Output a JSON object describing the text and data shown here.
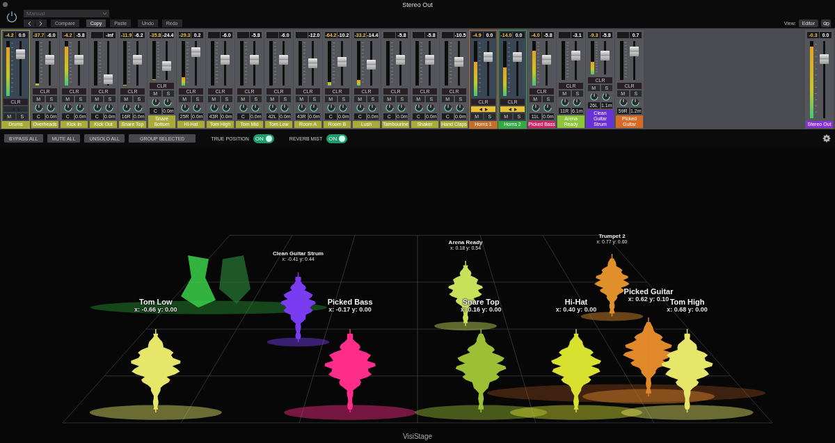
{
  "window": {
    "title": "Stereo Out"
  },
  "toolbar": {
    "preset": "Manual",
    "buttons": [
      {
        "label": "Compare",
        "selected": false
      },
      {
        "label": "Copy",
        "selected": true
      },
      {
        "label": "Paste",
        "selected": false
      },
      {
        "label": "Undo",
        "selected": false
      },
      {
        "label": "Redo",
        "selected": false
      }
    ],
    "view_label": "View:",
    "view_value": "Editor"
  },
  "strips": [
    {
      "kind": "stack",
      "name": "Drums",
      "color": "#a9aa3a",
      "peak": "-4.2",
      "volume": "0.0",
      "clr": "CLR",
      "mute": "M",
      "solo": "S",
      "meter": {
        "level": 0.88
      },
      "fader": {
        "level": 0.82
      }
    },
    {
      "kind": "track",
      "name": "Overheads",
      "color": "#a9aa3a",
      "peak": "-37.7",
      "volume": "-6.0",
      "clr": "CLR",
      "mute": "M",
      "solo": "S",
      "pan": "C",
      "send": "0.0m",
      "meter": {
        "level": 0.04
      },
      "fader": {
        "level": 0.6
      }
    },
    {
      "kind": "track",
      "name": "Kick In",
      "color": "#a9aa3a",
      "peak": "-4.2",
      "volume": "-5.8",
      "clr": "CLR",
      "mute": "M",
      "solo": "S",
      "pan": "C",
      "send": "0.0m",
      "meter": {
        "level": 0.88
      },
      "fader": {
        "level": 0.6
      }
    },
    {
      "kind": "track",
      "name": "Kick Out",
      "color": "#a9aa3a",
      "volume": "-inf",
      "clr": "CLR",
      "mute": "M",
      "solo": "S",
      "pan": "C",
      "send": "0.0m",
      "fader": {
        "level": 0.05
      }
    },
    {
      "kind": "track",
      "name": "Snare Top",
      "color": "#a9aa3a",
      "peak": "-11.9",
      "volume": "-6.2",
      "clr": "CLR",
      "mute": "M",
      "solo": "S",
      "pan": "16R",
      "send": "0.0m",
      "meter": {
        "level": 0.02
      },
      "fader": {
        "level": 0.6
      }
    },
    {
      "kind": "track",
      "name": "Snare Bottom",
      "color": "#a9aa3a",
      "peak": "-35.8",
      "volume": "-24.4",
      "clr": "CLR",
      "mute": "M",
      "solo": "S",
      "pan": "C",
      "send": "0.0m",
      "meter": {
        "level": 0.02
      },
      "fader": {
        "level": 0.3
      }
    },
    {
      "kind": "track",
      "name": "Hi-Hat",
      "color": "#a9aa3a",
      "peak": "-29.3",
      "volume": "0.2",
      "clr": "CLR",
      "mute": "M",
      "solo": "S",
      "pan": "25R",
      "send": "0.0m",
      "meter": {
        "level": 0.18
      },
      "fader": {
        "level": 0.82
      }
    },
    {
      "kind": "track",
      "name": "Tom High",
      "color": "#a9aa3a",
      "volume": "-6.0",
      "clr": "CLR",
      "mute": "M",
      "solo": "S",
      "pan": "43R",
      "send": "0.0m",
      "fader": {
        "level": 0.6
      }
    },
    {
      "kind": "track",
      "name": "Tom Mid",
      "color": "#a9aa3a",
      "volume": "-5.8",
      "clr": "CLR",
      "mute": "M",
      "solo": "S",
      "pan": "C",
      "send": "0.0m",
      "fader": {
        "level": 0.6
      }
    },
    {
      "kind": "track",
      "name": "Tom Low",
      "color": "#a9aa3a",
      "volume": "-6.0",
      "clr": "CLR",
      "mute": "M",
      "solo": "S",
      "pan": "42L",
      "send": "0.0m",
      "fader": {
        "level": 0.6
      }
    },
    {
      "kind": "track",
      "name": "Room A",
      "color": "#a9aa3a",
      "volume": "-12.0",
      "clr": "CLR",
      "mute": "M",
      "solo": "S",
      "pan": "43R",
      "send": "0.0m",
      "fader": {
        "level": 0.5
      }
    },
    {
      "kind": "track",
      "name": "Room B",
      "color": "#a9aa3a",
      "peak": "-64.2",
      "volume": "-10.2",
      "clr": "CLR",
      "mute": "M",
      "solo": "S",
      "pan": "C",
      "send": "0.0m",
      "meter": {
        "level": 0.08
      },
      "fader": {
        "level": 0.54
      }
    },
    {
      "kind": "track",
      "name": "Lush",
      "color": "#a9aa3a",
      "peak": "-33.2",
      "volume": "-14.4",
      "clr": "CLR",
      "mute": "M",
      "solo": "S",
      "pan": "C",
      "send": "0.0m",
      "meter": {
        "level": 0.12
      },
      "fader": {
        "level": 0.46
      }
    },
    {
      "kind": "track",
      "name": "Tambourine",
      "color": "#a9aa3a",
      "volume": "-5.8",
      "clr": "CLR",
      "mute": "M",
      "solo": "S",
      "pan": "C",
      "send": "0.0m",
      "fader": {
        "level": 0.6
      }
    },
    {
      "kind": "track",
      "name": "Shaker",
      "color": "#a9aa3a",
      "volume": "-5.8",
      "clr": "CLR",
      "mute": "M",
      "solo": "S",
      "pan": "C",
      "send": "0.0m",
      "fader": {
        "level": 0.6
      }
    },
    {
      "kind": "track",
      "name": "Hand Claps",
      "color": "#a9aa3a",
      "volume": "-10.5",
      "clr": "CLR",
      "mute": "M",
      "solo": "S",
      "pan": "C",
      "send": "0.0m",
      "fader": {
        "level": 0.54
      }
    },
    {
      "kind": "stack",
      "name": "Horns 1",
      "color": "#c0702a",
      "peak": "-4.9",
      "volume": "0.0",
      "clr": "CLR",
      "mute": "M",
      "solo": "S",
      "meter": {
        "level": 0.62
      },
      "fader": {
        "level": 0.76
      }
    },
    {
      "kind": "stack",
      "name": "Horns 2",
      "color": "#35a844",
      "peak": "-14.0",
      "volume": "0.0",
      "clr": "CLR",
      "mute": "M",
      "solo": "S",
      "meter": {
        "level": 0.52
      },
      "fader": {
        "level": 0.76
      }
    },
    {
      "kind": "track",
      "name": "Picked Bass",
      "color": "#d42468",
      "peak": "-4.0",
      "volume": "-5.8",
      "clr": "CLR",
      "mute": "M",
      "solo": "S",
      "pan": "11L",
      "send": "0.0m",
      "meter": {
        "level": 0.78
      },
      "fader": {
        "level": 0.6
      }
    },
    {
      "kind": "track",
      "name": "Arena Ready",
      "color": "#8cc43a",
      "volume": "-3.1",
      "clr": "CLR",
      "mute": "M",
      "solo": "S",
      "pan": "11R",
      "send": "6.1m",
      "fader": {
        "level": 0.66
      }
    },
    {
      "kind": "track",
      "name": "Clean Guitar Strum",
      "color": "#6a30d8",
      "peak": "-9.3",
      "volume": "-5.8",
      "clr": "CLR",
      "mute": "M",
      "solo": "S",
      "pan": "26L",
      "send": "1.1m",
      "meter": {
        "level": 0.38
      },
      "fader": {
        "level": 0.6
      }
    },
    {
      "kind": "track",
      "name": "Picked Guitar",
      "color": "#d86a28",
      "volume": "0.7",
      "clr": "CLR",
      "mute": "M",
      "solo": "S",
      "pan": "59R",
      "send": "1.2m",
      "fader": {
        "level": 0.82
      }
    },
    {
      "kind": "output",
      "name": "Stereo Out",
      "color": "#8a30d8",
      "peak": "-0.3",
      "volume": "0.0",
      "meter": {
        "level": 0.93
      },
      "fader": {
        "level": 0.8
      }
    }
  ],
  "controls": {
    "buttons": [
      "BYPASS ALL",
      "MUTE ALL",
      "UNSOLO ALL",
      "GROUP SELECTED"
    ],
    "toggles": [
      {
        "label": "TRUE POSITION",
        "text": "ON",
        "on": true
      },
      {
        "label": "REVERB MIST",
        "text": "ON",
        "on": true
      }
    ]
  },
  "stage": {
    "caption": "VisiStage",
    "sources": [
      {
        "name": "Trumpet 2",
        "coords": "x: 0.77  y: 0.60",
        "color": "#e0902a"
      },
      {
        "name": "Arena Ready",
        "coords": "x: 0.18  y: 0.54",
        "color": "#c8e05a"
      },
      {
        "name": "Clean Guitar Strum",
        "coords": "x: -0.41  y: 0.44",
        "color": "#7a3cf0"
      },
      {
        "name": "Picked Guitar",
        "coords": "x: 0.62  y: 0.10",
        "color": "#e0882a"
      },
      {
        "name": "Tom Low",
        "coords": "x: -0.66  y: 0.00",
        "color": "#e6e66a"
      },
      {
        "name": "Picked Bass",
        "coords": "x: -0.17  y: 0.00",
        "color": "#ff2d8a"
      },
      {
        "name": "Snare Top",
        "coords": "x: 0.16  y: 0.00",
        "color": "#9cbf36"
      },
      {
        "name": "Hi-Hat",
        "coords": "x: 0.40  y: 0.00",
        "color": "#d8e030"
      },
      {
        "name": "Tom High",
        "coords": "x: 0.68  y: 0.00",
        "color": "#e6e66a"
      }
    ]
  }
}
